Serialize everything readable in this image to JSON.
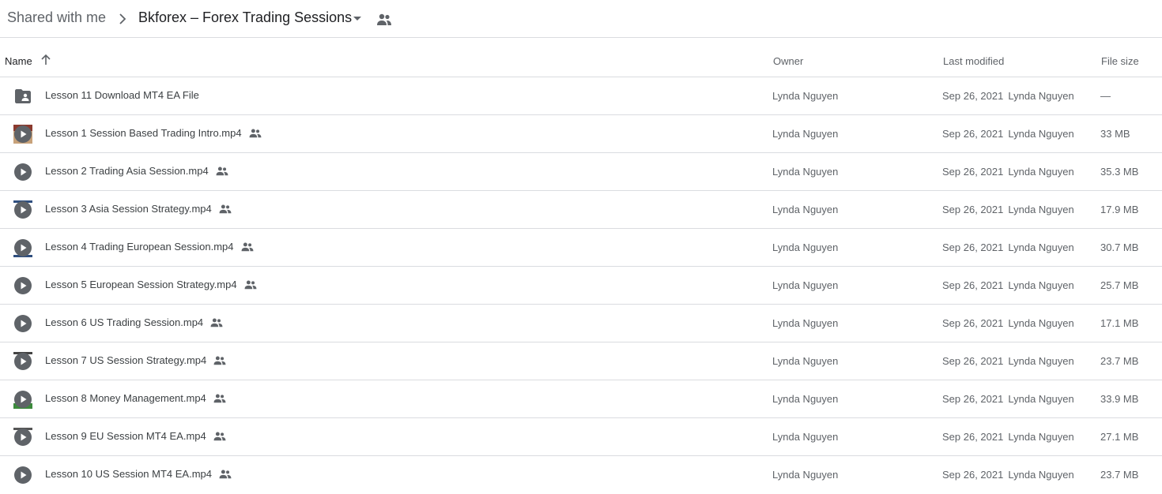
{
  "breadcrumb": {
    "root": "Shared with me",
    "current": "Bkforex – Forex Trading Sessions",
    "dropdown_icon": "arrow-drop-down-icon",
    "shared_icon": "people-icon"
  },
  "columns": {
    "name": "Name",
    "owner": "Owner",
    "last_modified": "Last modified",
    "file_size": "File size",
    "sort_icon": "arrow-up-icon"
  },
  "colors": {
    "icon_gray": "#5f6368",
    "divider": "#dadce0",
    "text_primary": "#202124"
  },
  "files": [
    {
      "name": "Lesson 11 Download MT4 EA File",
      "type": "shared-folder",
      "shared": false,
      "owner": "Lynda Nguyen",
      "modified_date": "Sep 26, 2021",
      "modified_by": "Lynda Nguyen",
      "size": "—"
    },
    {
      "name": "Lesson 1 Session Based Trading Intro.mp4",
      "type": "video",
      "shared": true,
      "owner": "Lynda Nguyen",
      "modified_date": "Sep 26, 2021",
      "modified_by": "Lynda Nguyen",
      "size": "33 MB"
    },
    {
      "name": "Lesson 2 Trading Asia Session.mp4",
      "type": "video",
      "shared": true,
      "owner": "Lynda Nguyen",
      "modified_date": "Sep 26, 2021",
      "modified_by": "Lynda Nguyen",
      "size": "35.3 MB"
    },
    {
      "name": "Lesson 3 Asia Session Strategy.mp4",
      "type": "video",
      "shared": true,
      "owner": "Lynda Nguyen",
      "modified_date": "Sep 26, 2021",
      "modified_by": "Lynda Nguyen",
      "size": "17.9 MB"
    },
    {
      "name": "Lesson 4 Trading European Session.mp4",
      "type": "video",
      "shared": true,
      "owner": "Lynda Nguyen",
      "modified_date": "Sep 26, 2021",
      "modified_by": "Lynda Nguyen",
      "size": "30.7 MB"
    },
    {
      "name": "Lesson 5 European Session Strategy.mp4",
      "type": "video",
      "shared": true,
      "owner": "Lynda Nguyen",
      "modified_date": "Sep 26, 2021",
      "modified_by": "Lynda Nguyen",
      "size": "25.7 MB"
    },
    {
      "name": "Lesson 6 US Trading Session.mp4",
      "type": "video",
      "shared": true,
      "owner": "Lynda Nguyen",
      "modified_date": "Sep 26, 2021",
      "modified_by": "Lynda Nguyen",
      "size": "17.1 MB"
    },
    {
      "name": "Lesson 7 US Session Strategy.mp4",
      "type": "video",
      "shared": true,
      "owner": "Lynda Nguyen",
      "modified_date": "Sep 26, 2021",
      "modified_by": "Lynda Nguyen",
      "size": "23.7 MB"
    },
    {
      "name": "Lesson 8 Money Management.mp4",
      "type": "video",
      "shared": true,
      "owner": "Lynda Nguyen",
      "modified_date": "Sep 26, 2021",
      "modified_by": "Lynda Nguyen",
      "size": "33.9 MB"
    },
    {
      "name": "Lesson 9 EU Session MT4 EA.mp4",
      "type": "video",
      "shared": true,
      "owner": "Lynda Nguyen",
      "modified_date": "Sep 26, 2021",
      "modified_by": "Lynda Nguyen",
      "size": "27.1 MB"
    },
    {
      "name": "Lesson 10 US Session MT4 EA.mp4",
      "type": "video",
      "shared": true,
      "owner": "Lynda Nguyen",
      "modified_date": "Sep 26, 2021",
      "modified_by": "Lynda Nguyen",
      "size": "23.7 MB"
    }
  ]
}
